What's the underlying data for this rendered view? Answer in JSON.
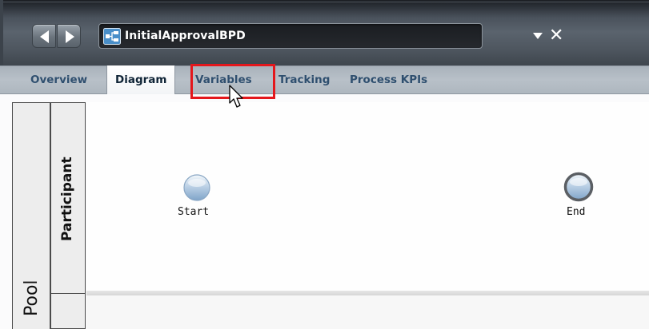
{
  "editor": {
    "document_name": "InitialApprovalBPD"
  },
  "tabs": [
    {
      "label": "Overview",
      "active": false
    },
    {
      "label": "Diagram",
      "active": true
    },
    {
      "label": "Variables",
      "active": false,
      "highlighted": true
    },
    {
      "label": "Tracking",
      "active": false
    },
    {
      "label": "Process KPIs",
      "active": false
    }
  ],
  "diagram": {
    "pool_label": "Pool",
    "lane_label": "Participant",
    "events": [
      {
        "label": "Start",
        "type": "start-event"
      },
      {
        "label": "End",
        "type": "end-event"
      }
    ]
  },
  "icons": {
    "back": "back-arrow-icon",
    "forward": "forward-arrow-icon",
    "document": "bpd-diagram-icon",
    "dropdown": "dropdown-arrow-icon",
    "close": "close-icon",
    "cursor": "mouse-pointer-icon"
  },
  "colors": {
    "highlight": "#e4171c",
    "tab_text": "#2f4f6f",
    "titlebar": "#4a525c"
  }
}
